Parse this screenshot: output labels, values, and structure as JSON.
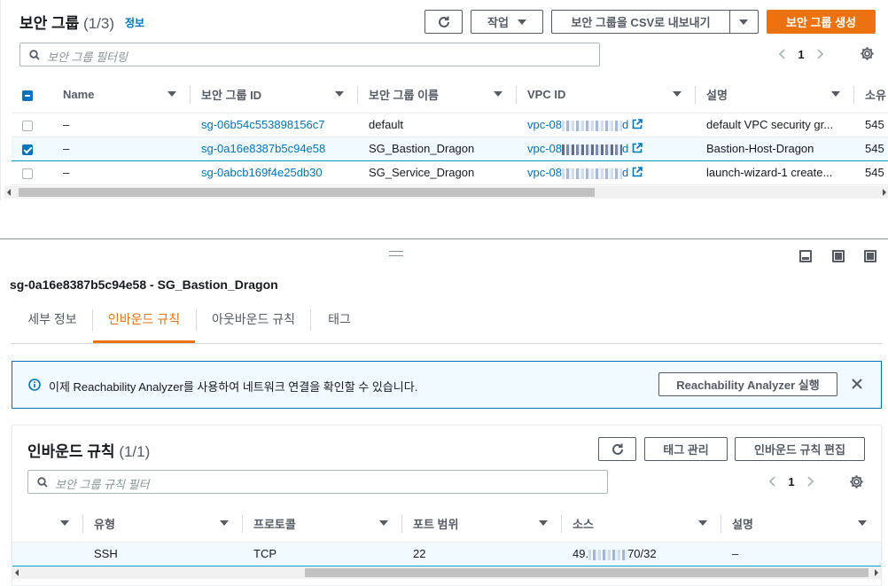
{
  "security_groups": {
    "title": "보안 그룹",
    "count": "(1/3)",
    "info_link": "정보",
    "buttons": {
      "actions": "작업",
      "export_csv": "보안 그룹을 CSV로 내보내기",
      "create": "보안 그룹 생성"
    },
    "filter_placeholder": "보안 그룹 필터링",
    "page": "1",
    "columns": [
      "Name",
      "보안 그룹 ID",
      "보안 그룹 이름",
      "VPC ID",
      "설명",
      "소유"
    ],
    "rows": [
      {
        "name": "–",
        "id": "sg-06b54c553898156c7",
        "group_name": "default",
        "vpc_prefix": "vpc-08",
        "vpc_suffix": "d",
        "description": "default VPC security gr...",
        "owner": "545",
        "selected": false
      },
      {
        "name": "–",
        "id": "sg-0a16e8387b5c94e58",
        "group_name": "SG_Bastion_Dragon",
        "vpc_prefix": "vpc-08",
        "vpc_suffix": "d",
        "description": "Bastion-Host-Dragon",
        "owner": "545",
        "selected": true
      },
      {
        "name": "–",
        "id": "sg-0abcb169f4e25db30",
        "group_name": "SG_Service_Dragon",
        "vpc_prefix": "vpc-08",
        "vpc_suffix": "d",
        "description": "launch-wizard-1 create...",
        "owner": "545",
        "selected": false
      }
    ]
  },
  "detail": {
    "title": "sg-0a16e8387b5c94e58 - SG_Bastion_Dragon",
    "tabs": [
      {
        "label": "세부 정보",
        "active": false
      },
      {
        "label": "인바운드 규칙",
        "active": true
      },
      {
        "label": "아웃바운드 규칙",
        "active": false
      },
      {
        "label": "태그",
        "active": false
      }
    ],
    "alert": {
      "message": "이제 Reachability Analyzer를 사용하여 네트워크 연결을 확인할 수 있습니다.",
      "button": "Reachability Analyzer 실행"
    },
    "inbound": {
      "title": "인바운드 규칙",
      "count": "(1/1)",
      "buttons": {
        "manage_tags": "태그 관리",
        "edit": "인바운드 규칙 편집"
      },
      "filter_placeholder": "보안 그룹 규칙 필터",
      "page": "1",
      "columns": [
        "유형",
        "프로토콜",
        "포트 범위",
        "소스",
        "설명"
      ],
      "rows": [
        {
          "type": "SSH",
          "protocol": "TCP",
          "port": "22",
          "source_prefix": "49.",
          "source_suffix": "70/32",
          "description": "–"
        }
      ]
    }
  },
  "colors": {
    "accent": "#ec7211",
    "link": "#0073bb",
    "selected_bg": "#f1faff"
  }
}
